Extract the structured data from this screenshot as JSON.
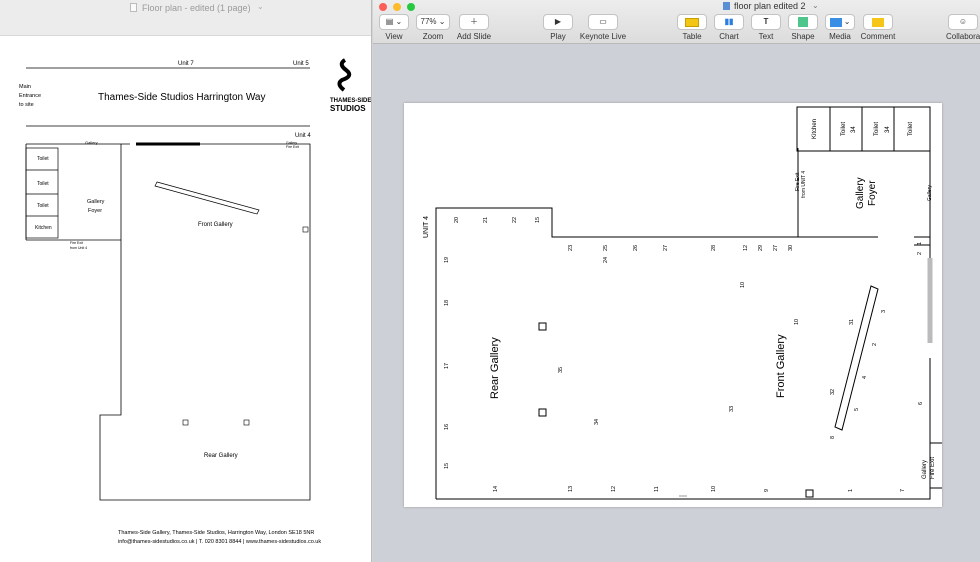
{
  "left_window": {
    "title": "Floor plan - edited (1 page)",
    "plan": {
      "unit7": "Unit 7",
      "unit5": "Unit 5",
      "unit4": "Unit 4",
      "main_entrance": [
        "Main",
        "Entrance",
        "to site"
      ],
      "heading": "Thames-Side Studios Harrington Way",
      "logo_text_1": "THAMES-SIDE",
      "logo_text_2": "STUDIOS",
      "gallery": "Gallery",
      "gallery_foyer": [
        "Gallery",
        "Foyer"
      ],
      "toilet": "Toilet",
      "kitchen": "Kitchen",
      "front_gallery": "Front Gallery",
      "rear_gallery": "Rear Gallery",
      "fire_exit": [
        "Gallery",
        "Fire Exit"
      ],
      "fire_exit_unit4": [
        "Fire Exit",
        "from Unit 4"
      ],
      "footer_1": "Thames-Side Gallery, Thames-Side Studios, Harrington Way, London SE18 5NR",
      "footer_2": "info@thames-sidestudios.co.uk | T. 020 8301 8844 | www.thames-sidestudios.co.uk"
    }
  },
  "right_window": {
    "title": "floor plan edited 2",
    "toolbar": {
      "view": "View",
      "zoom_value": "77%",
      "zoom": "Zoom",
      "add_slide": "Add Slide",
      "play": "Play",
      "keynote_live": "Keynote Live",
      "table": "Table",
      "chart": "Chart",
      "text": "Text",
      "shape": "Shape",
      "media": "Media",
      "comment": "Comment",
      "collaborate": "Collabora"
    },
    "slide": {
      "unit4": "UNIT 4",
      "kitchen": "Kitchen",
      "toilet": "Toilet",
      "thirty_four": "34",
      "gallery_foyer": [
        "Gallery",
        "Foyer"
      ],
      "fire_exit_unit4": [
        "Fire Exit",
        "from UNIT 4"
      ],
      "gallery": "Gallery",
      "fire_exit": [
        "Gallery",
        "Fire Exit"
      ],
      "rear_gallery": "Rear Gallery",
      "front_gallery": "Front Gallery",
      "top_numbers": [
        "20",
        "21",
        "22",
        "15"
      ],
      "row_numbers": [
        "23",
        "25",
        "26",
        "27",
        "28",
        "12",
        "29",
        "27",
        "30"
      ],
      "row2_numbers": [
        "24"
      ],
      "left_numbers": [
        "19",
        "18",
        "17",
        "16",
        "15"
      ],
      "bottom_numbers": [
        "14",
        "13",
        "12",
        "11",
        "10",
        "9",
        "1",
        "7"
      ],
      "misc_numbers": [
        "10",
        "10",
        "35",
        "34",
        "33",
        "31",
        "3",
        "2",
        "4",
        "32",
        "5",
        "8",
        "6",
        "2",
        "1"
      ]
    }
  }
}
